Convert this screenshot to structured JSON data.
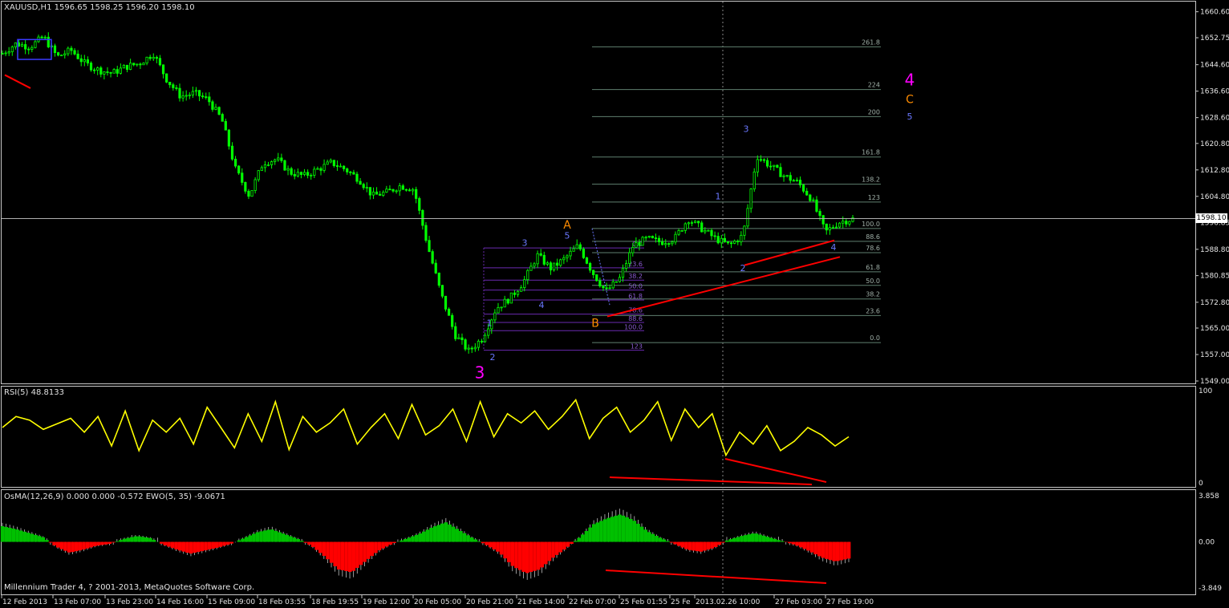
{
  "header": {
    "main": "XAUUSD,H1  1596.65 1598.25 1596.20 1598.10",
    "rsi": "RSI(5) 48.8133",
    "osma": "OsMA(12,26,9) 0.000 0.000 -0.572  EWO(5, 35) -9.0671"
  },
  "current_price": "1598.10",
  "footer": "Millennium Trader 4, ? 2001-2013, MetaQuotes Software Corp.",
  "colors": {
    "candle": "#00ff00",
    "rsi": "#ffff00",
    "trend": "#ff0000",
    "pink": "#ff00ff",
    "orange": "#ff8c00",
    "blue": "#6a78ff",
    "osma_up": "#00c000",
    "osma_down": "#ff0000",
    "ewo": "#c0c0c0"
  },
  "chart_data": [
    {
      "type": "candlestick",
      "symbol": "XAUUSD",
      "timeframe": "H1",
      "ylim": [
        1549.0,
        1661.0
      ],
      "y_ticks": [
        "1660.60",
        "1652.75",
        "1644.60",
        "1636.60",
        "1628.60",
        "1620.80",
        "1612.80",
        "1604.80",
        "1596.85",
        "1588.80",
        "1580.85",
        "1572.80",
        "1565.00",
        "1557.00",
        "1549.00"
      ],
      "x_ticks": [
        "12 Feb 2013",
        "13 Feb 07:00",
        "13 Feb 23:00",
        "14 Feb 16:00",
        "15 Feb 09:00",
        "18 Feb 03:55",
        "18 Feb 19:55",
        "19 Feb 12:00",
        "20 Feb 05:00",
        "20 Feb 21:00",
        "21 Feb 14:00",
        "22 Feb 07:00",
        "25 Feb 01:55",
        "25 Fe",
        "2013.02.26 10:00",
        "27 Feb 03:00",
        "27 Feb 19:00"
      ],
      "close_path": [
        1648,
        1651,
        1650,
        1653,
        1647,
        1649,
        1645,
        1643,
        1642,
        1644,
        1645,
        1648,
        1640,
        1635,
        1636,
        1634,
        1628,
        1613,
        1605,
        1615,
        1616,
        1612,
        1611,
        1613,
        1615,
        1613,
        1610,
        1605,
        1606,
        1608,
        1607,
        1590,
        1575,
        1563,
        1558,
        1562,
        1571,
        1574,
        1579,
        1587,
        1583,
        1586,
        1590,
        1582,
        1576,
        1580,
        1590,
        1592,
        1591,
        1592,
        1598,
        1595,
        1592,
        1590,
        1593,
        1617,
        1614,
        1611,
        1609,
        1604,
        1594,
        1597,
        1598
      ],
      "annotations": [
        {
          "text": "3",
          "color": "pink",
          "price": 1551.5,
          "size": "big"
        },
        {
          "text": "4",
          "color": "pink",
          "price": 1640.0,
          "size": "big"
        },
        {
          "text": "C",
          "color": "orange",
          "price": 1634.2,
          "size": "mid"
        },
        {
          "text": "5",
          "color": "blue",
          "price": 1629.0,
          "size": "small"
        },
        {
          "text": "A",
          "color": "orange",
          "price": 1596.2,
          "size": "mid"
        },
        {
          "text": "B",
          "color": "orange",
          "price": 1566.5,
          "size": "mid"
        },
        {
          "text": "1",
          "color": "blue",
          "price": 1566.5
        },
        {
          "text": "2",
          "color": "blue",
          "price": 1556.2
        },
        {
          "text": "3",
          "color": "blue",
          "price": 1590.8
        },
        {
          "text": "4",
          "color": "blue",
          "price": 1572.0
        },
        {
          "text": "5",
          "color": "blue",
          "price": 1593.0
        },
        {
          "text": "1",
          "color": "blue",
          "price": 1604.8
        },
        {
          "text": "2",
          "color": "blue",
          "price": 1583.2
        },
        {
          "text": "3",
          "color": "blue",
          "price": 1625.2
        },
        {
          "text": "4",
          "color": "blue",
          "price": 1589.5
        }
      ],
      "fib_right": [
        "261.8",
        "224",
        "200",
        "161.8",
        "138.2",
        "123",
        "100.0",
        "88.6",
        "78.6",
        "61.8",
        "50.0",
        "38.2",
        "23.6",
        "0.0"
      ],
      "fib_right_prices": [
        1650.0,
        1637.1,
        1628.9,
        1616.7,
        1608.5,
        1603.1,
        1595.1,
        1591.2,
        1587.8,
        1582.0,
        1577.9,
        1573.8,
        1568.8,
        1560.6
      ],
      "fib_left": [
        "0.0",
        "23.6",
        "38.2",
        "50.0",
        "61.8",
        "78.6",
        "88.6",
        "100.0",
        "123"
      ],
      "fib_left_prices": [
        1589.2,
        1583.2,
        1579.5,
        1576.5,
        1573.5,
        1569.2,
        1566.7,
        1564.2,
        1558.3
      ]
    },
    {
      "type": "line",
      "name": "RSI(5) 48.8133",
      "ylim": [
        0,
        100
      ],
      "y_ticks": [
        "100",
        "0"
      ],
      "values": [
        60,
        72,
        68,
        58,
        64,
        70,
        55,
        72,
        40,
        78,
        35,
        68,
        55,
        70,
        42,
        82,
        60,
        38,
        75,
        45,
        88,
        36,
        72,
        55,
        65,
        80,
        42,
        60,
        75,
        48,
        85,
        52,
        62,
        80,
        45,
        88,
        50,
        75,
        65,
        78,
        58,
        72,
        90,
        48,
        70,
        82,
        55,
        68,
        88,
        46,
        80,
        60,
        75,
        30,
        55,
        42,
        62,
        35,
        45,
        60,
        52,
        40,
        50
      ]
    },
    {
      "type": "bar",
      "name": "OsMA(12,26,9) / EWO(5, 35)",
      "ylim": [
        -3.849,
        3.858
      ],
      "y_ticks": [
        "3.858",
        "0.00",
        "-3.849"
      ],
      "values": [
        1.6,
        1.3,
        0.9,
        0.5,
        -0.5,
        -1.1,
        -0.8,
        -0.4,
        -0.2,
        0.3,
        0.6,
        0.4,
        -0.3,
        -0.8,
        -1.2,
        -0.9,
        -0.6,
        -0.2,
        0.4,
        1.0,
        1.3,
        0.8,
        0.3,
        -0.4,
        -1.5,
        -2.8,
        -3.1,
        -2.0,
        -0.9,
        -0.2,
        0.3,
        0.8,
        1.5,
        2.0,
        1.2,
        0.4,
        -0.3,
        -1.1,
        -2.5,
        -3.2,
        -2.8,
        -1.6,
        -0.6,
        0.5,
        1.8,
        2.4,
        2.8,
        2.2,
        1.1,
        0.4,
        -0.2,
        -0.8,
        -1.0,
        -0.6,
        0.2,
        0.6,
        0.9,
        0.5,
        0.1,
        -0.3,
        -0.9,
        -1.6,
        -2.0,
        -1.7
      ]
    }
  ]
}
